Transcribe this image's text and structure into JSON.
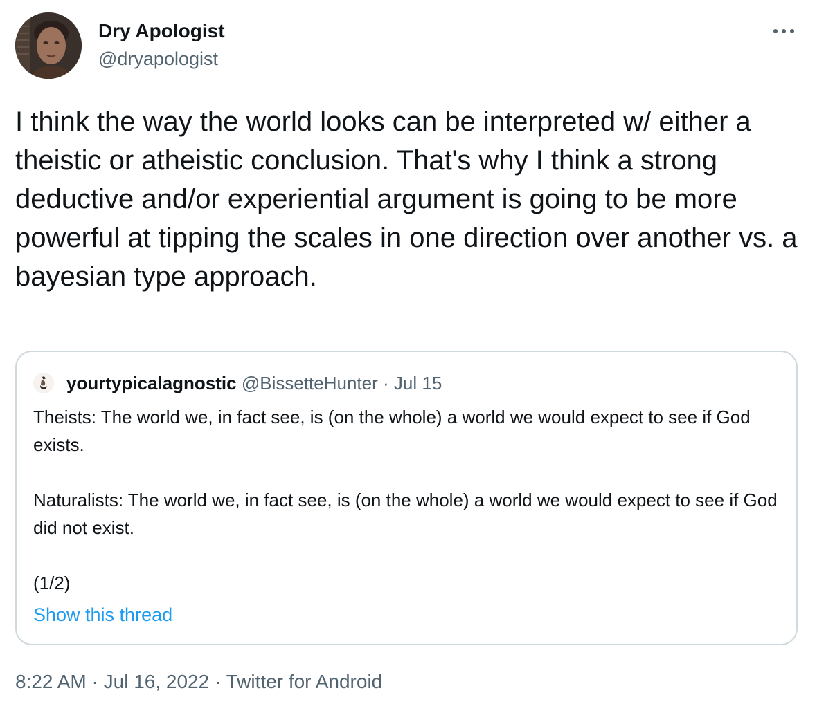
{
  "author": {
    "display_name": "Dry Apologist",
    "handle": "@dryapologist",
    "avatar_icon": "profile-photo"
  },
  "more_icon": "more-horizontal-icon",
  "tweet_text": "I think the way the world looks can be interpreted w/ either a theistic or atheistic conclusion. That's why I think a strong deductive and/or experiential argument is going to be more powerful at tipping the scales in one direction over another vs. a bayesian type approach.",
  "quoted_tweet": {
    "display_name": "yourtypicalagnostic",
    "handle": "@BissetteHunter",
    "separator": "·",
    "date": "Jul 15",
    "text": "Theists: The world we, in fact see, is (on the whole) a world we would expect to see if God exists.\n\nNaturalists: The world we, in fact see, is (on the whole) a world we would expect to see if God did not exist.\n\n(1/2)",
    "show_thread_label": "Show this thread"
  },
  "meta": {
    "time": "8:22 AM",
    "separator": "·",
    "date": "Jul 16, 2022",
    "source": "Twitter for Android"
  },
  "colors": {
    "text_primary": "#0f1419",
    "text_secondary": "#536471",
    "link": "#1d9bf0",
    "border": "#cfd9de"
  }
}
